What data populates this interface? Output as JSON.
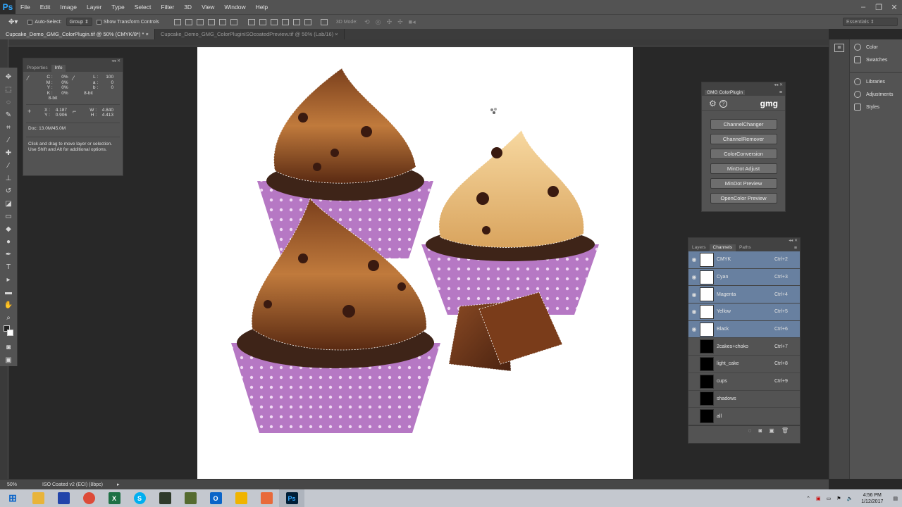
{
  "app": {
    "logo": "Ps"
  },
  "menubar": {
    "items": [
      "File",
      "Edit",
      "Image",
      "Layer",
      "Type",
      "Select",
      "Filter",
      "3D",
      "View",
      "Window",
      "Help"
    ]
  },
  "optionsbar": {
    "auto_select_label": "Auto-Select:",
    "group_value": "Group",
    "show_transform_label": "Show Transform Controls",
    "mode_3d_label": "3D Mode:",
    "workspace": "Essentials"
  },
  "tabs": [
    {
      "label": "Cupcake_Demo_GMG_ColorPlugin.tif @ 50% (CMYK/8*) *",
      "close": "×",
      "active": true
    },
    {
      "label": "Cupcake_Demo_GMG_ColorPluginISOcoatedPreview.tif @ 50% (Lab/16)",
      "close": "×",
      "active": false
    }
  ],
  "info_panel": {
    "tabs": [
      "Properties",
      "Info"
    ],
    "cmyk": {
      "c": "0%",
      "m": "0%",
      "y": "0%",
      "k": "0%"
    },
    "lab": {
      "l": "100",
      "a": "0",
      "b": "0"
    },
    "bits_left": "8-bit",
    "bits_right": "8-bit",
    "x": "4.187",
    "y": "0.906",
    "w": "4.840",
    "h": "4.413",
    "doc": "Doc: 13.0M/45.0M",
    "hint": "Click and drag to move layer or selection. Use Shift and Alt for additional options."
  },
  "gmg_panel": {
    "title": "GMG ColorPlugin",
    "brand": "gmg",
    "buttons": [
      "ChannelChanger",
      "ChannelRemover",
      "ColorConversion",
      "MinDot Adjust",
      "MinDot Preview",
      "OpenColor Preview"
    ]
  },
  "channels_panel": {
    "tabs": [
      "Layers",
      "Channels",
      "Paths"
    ],
    "rows": [
      {
        "name": "CMYK",
        "shortcut": "Ctrl+2",
        "selected": true,
        "visible": true,
        "mask": false
      },
      {
        "name": "Cyan",
        "shortcut": "Ctrl+3",
        "selected": true,
        "visible": true,
        "mask": false
      },
      {
        "name": "Magenta",
        "shortcut": "Ctrl+4",
        "selected": true,
        "visible": true,
        "mask": false
      },
      {
        "name": "Yellow",
        "shortcut": "Ctrl+5",
        "selected": true,
        "visible": true,
        "mask": false
      },
      {
        "name": "Black",
        "shortcut": "Ctrl+6",
        "selected": true,
        "visible": true,
        "mask": false
      },
      {
        "name": "2cakes+choko",
        "shortcut": "Ctrl+7",
        "selected": false,
        "visible": false,
        "mask": true
      },
      {
        "name": "light_cake",
        "shortcut": "Ctrl+8",
        "selected": false,
        "visible": false,
        "mask": true
      },
      {
        "name": "cups",
        "shortcut": "Ctrl+9",
        "selected": false,
        "visible": false,
        "mask": true
      },
      {
        "name": "shadows",
        "shortcut": "",
        "selected": false,
        "visible": false,
        "mask": true
      },
      {
        "name": "all",
        "shortcut": "",
        "selected": false,
        "visible": false,
        "mask": true
      }
    ]
  },
  "right_dock": {
    "items": [
      "Color",
      "Swatches",
      "Libraries",
      "Adjustments",
      "Styles"
    ]
  },
  "statusbar": {
    "zoom": "50%",
    "profile": "ISO Coated v2 (ECI) (8bpc)"
  },
  "taskbar": {
    "time": "4:56 PM",
    "date": "1/12/2017"
  },
  "colors": {
    "selected_channel": "#6880a0",
    "panel_bg": "#535353",
    "ps_blue": "#31a8ff"
  }
}
